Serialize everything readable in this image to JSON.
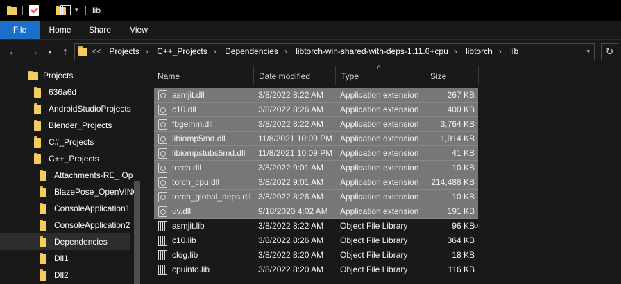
{
  "window": {
    "title": "lib"
  },
  "ribbon": {
    "tabs": [
      "File",
      "Home",
      "Share",
      "View"
    ]
  },
  "address": {
    "overflow": "<<",
    "crumbs": [
      "Projects",
      "C++_Projects",
      "Dependencies",
      "libtorch-win-shared-with-deps-1.11.0+cpu",
      "libtorch",
      "lib"
    ]
  },
  "nav": {
    "items": [
      {
        "label": "Projects"
      },
      {
        "label": "636a6d"
      },
      {
        "label": "AndroidStudioProjects"
      },
      {
        "label": "Blender_Projects"
      },
      {
        "label": "C#_Projects"
      },
      {
        "label": "C++_Projects"
      },
      {
        "label": "Attachments-RE_ Op"
      },
      {
        "label": "BlazePose_OpenVINO"
      },
      {
        "label": "ConsoleApplication1"
      },
      {
        "label": "ConsoleApplication2"
      },
      {
        "label": "Dependencies"
      },
      {
        "label": "Dll1"
      },
      {
        "label": "Dll2"
      }
    ],
    "selected": "Dependencies"
  },
  "columns": {
    "name": "Name",
    "date": "Date modified",
    "type": "Type",
    "size": "Size"
  },
  "files": [
    {
      "name": "asmjit.dll",
      "date": "3/8/2022 8:22 AM",
      "type": "Application extension",
      "size": "267 KB",
      "kind": "dll",
      "selected": true
    },
    {
      "name": "c10.dll",
      "date": "3/8/2022 8:26 AM",
      "type": "Application extension",
      "size": "400 KB",
      "kind": "dll",
      "selected": true
    },
    {
      "name": "fbgemm.dll",
      "date": "3/8/2022 8:22 AM",
      "type": "Application extension",
      "size": "3,764 KB",
      "kind": "dll",
      "selected": true
    },
    {
      "name": "libiomp5md.dll",
      "date": "11/8/2021 10:09 PM",
      "type": "Application extension",
      "size": "1,914 KB",
      "kind": "dll",
      "selected": true
    },
    {
      "name": "libiompstubs5md.dll",
      "date": "11/8/2021 10:09 PM",
      "type": "Application extension",
      "size": "41 KB",
      "kind": "dll",
      "selected": true
    },
    {
      "name": "torch.dll",
      "date": "3/8/2022 9:01 AM",
      "type": "Application extension",
      "size": "10 KB",
      "kind": "dll",
      "selected": true
    },
    {
      "name": "torch_cpu.dll",
      "date": "3/8/2022 9:01 AM",
      "type": "Application extension",
      "size": "214,488 KB",
      "kind": "dll",
      "selected": true
    },
    {
      "name": "torch_global_deps.dll",
      "date": "3/8/2022 8:26 AM",
      "type": "Application extension",
      "size": "10 KB",
      "kind": "dll",
      "selected": true
    },
    {
      "name": "uv.dll",
      "date": "9/18/2020 4:02 AM",
      "type": "Application extension",
      "size": "191 KB",
      "kind": "dll",
      "selected": true
    },
    {
      "name": "asmjit.lib",
      "date": "3/8/2022 8:22 AM",
      "type": "Object File Library",
      "size": "96 KB",
      "kind": "lib",
      "selected": false
    },
    {
      "name": "c10.lib",
      "date": "3/8/2022 8:26 AM",
      "type": "Object File Library",
      "size": "364 KB",
      "kind": "lib",
      "selected": false
    },
    {
      "name": "clog.lib",
      "date": "3/8/2022 8:20 AM",
      "type": "Object File Library",
      "size": "18 KB",
      "kind": "lib",
      "selected": false
    },
    {
      "name": "cpuinfo.lib",
      "date": "3/8/2022 8:20 AM",
      "type": "Object File Library",
      "size": "116 KB",
      "kind": "lib",
      "selected": false
    }
  ]
}
